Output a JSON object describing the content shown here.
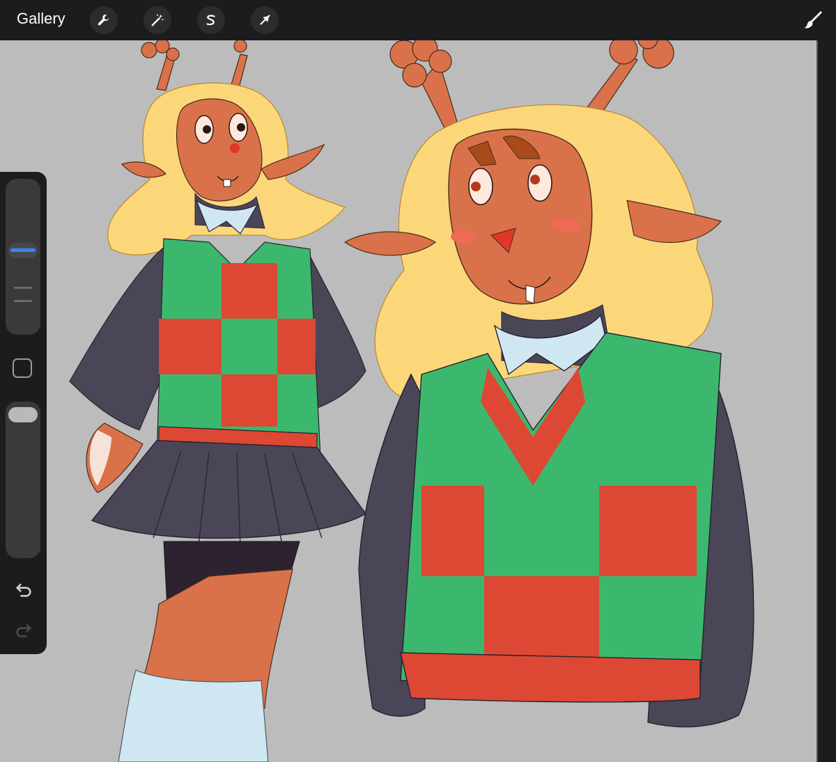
{
  "topbar": {
    "gallery_label": "Gallery",
    "tools": [
      "wrench-icon",
      "magic-wand-icon",
      "selection-icon",
      "transform-arrow-icon"
    ],
    "right_tool": "paintbrush-icon"
  },
  "sidebar": {
    "brush_size_level": 0.55,
    "opacity_level": 1.0
  },
  "colors": {
    "toolbar": "#1c1c1e",
    "canvas": "#bcbcbc",
    "accent": "#3b82f6",
    "skin": "#d9724a",
    "hair": "#fcd77a",
    "sweater_green": "#3cb86e",
    "sweater_red": "#dc4834",
    "sleeves": "#4a4658",
    "collar": "#cfe7f0"
  }
}
